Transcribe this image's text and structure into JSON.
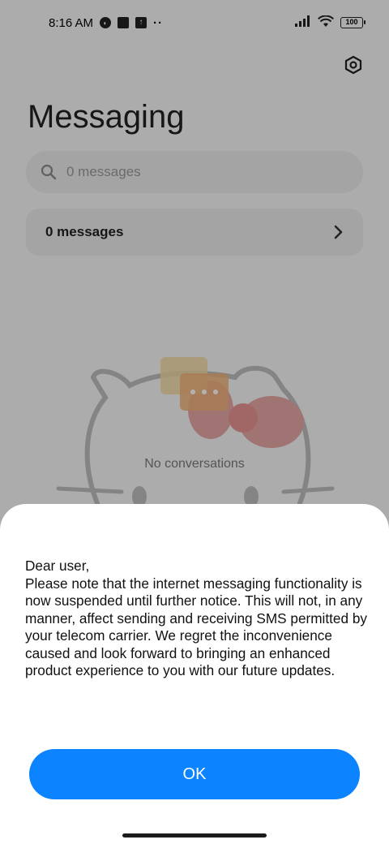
{
  "status_bar": {
    "time": "8:16 AM",
    "notification_icons": [
      "circle-app-icon",
      "square-app-icon",
      "upload-icon"
    ],
    "more": "··",
    "battery": "100"
  },
  "page": {
    "title": "Messaging",
    "search_placeholder": "0 messages",
    "summary_label": "0 messages",
    "empty_state": "No conversations"
  },
  "dialog": {
    "message": "Dear user,\nPlease note that the internet messaging functionality is now suspended until further notice. This will not, in any manner, affect sending and receiving SMS permitted by your telecom carrier. We regret the inconvenience caused and look forward to bringing an enhanced product experience to you with our future updates.",
    "ok_label": "OK"
  },
  "colors": {
    "accent": "#0d84ff",
    "sheet_bg": "#ffffff",
    "overlay": "rgba(0,0,0,0.30)"
  }
}
